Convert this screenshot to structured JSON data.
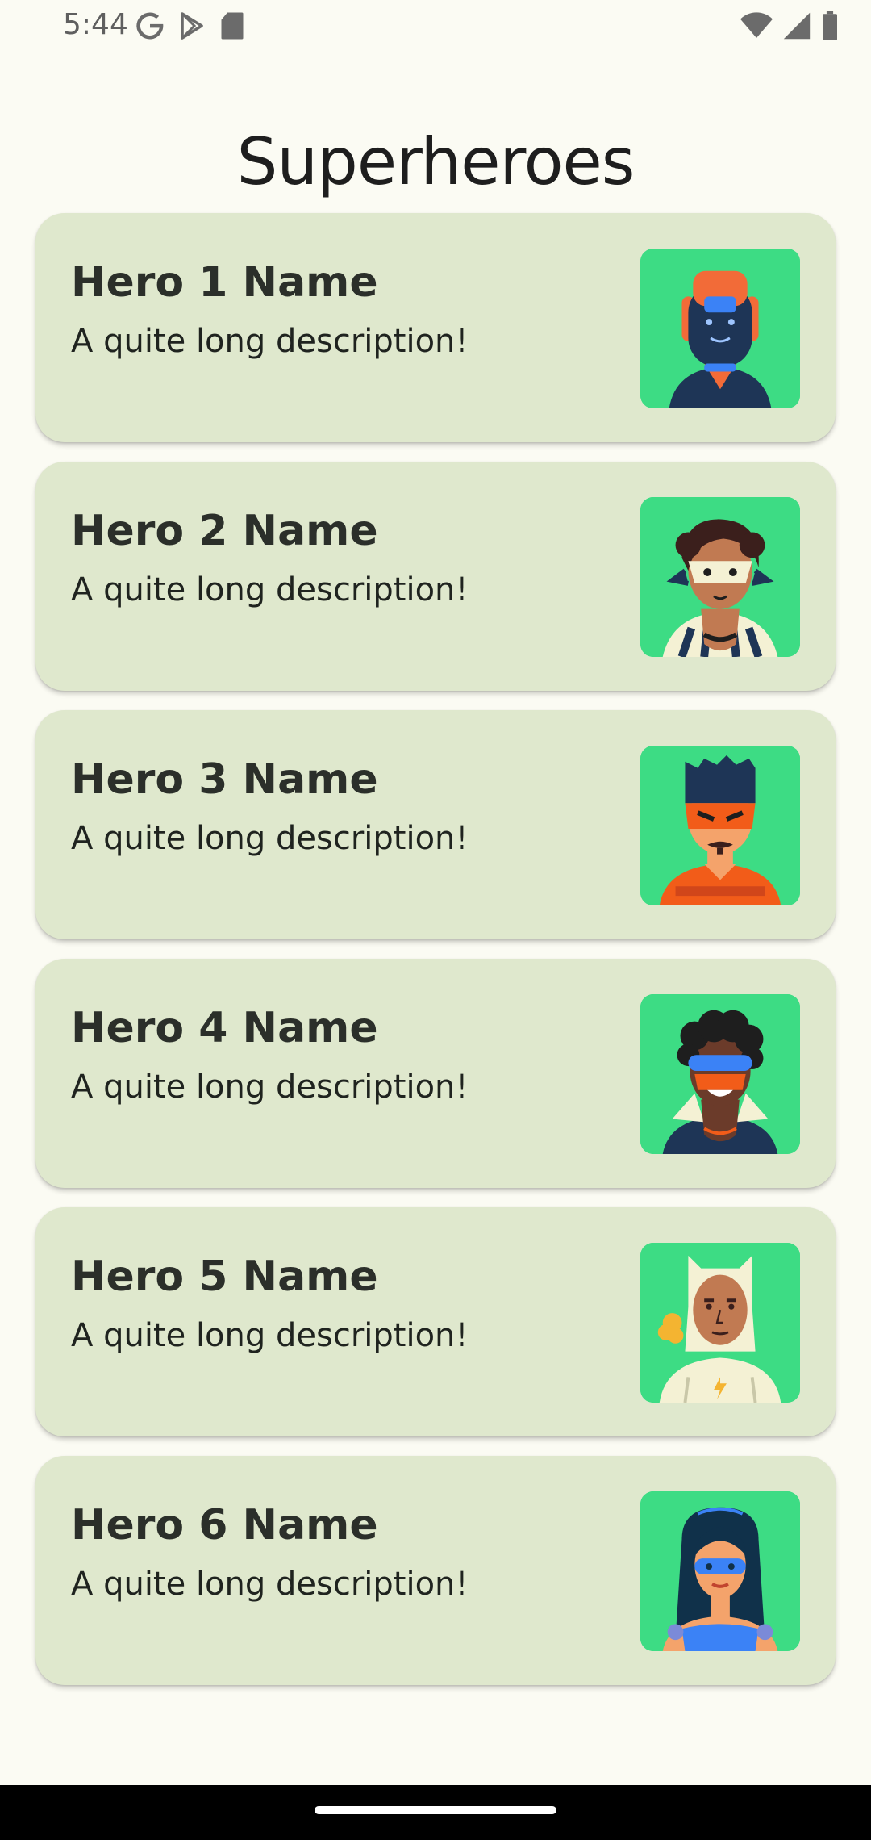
{
  "status_bar": {
    "time": "5:44",
    "left_icons": [
      "google-icon",
      "play-store-icon",
      "sd-card-icon"
    ],
    "right_icons": [
      "wifi-icon",
      "signal-icon",
      "battery-icon"
    ]
  },
  "app": {
    "title": "Superheroes"
  },
  "heroes": [
    {
      "name": "Hero 1 Name",
      "description": "A quite long description!",
      "avatar_icon": "hero-1-avatar"
    },
    {
      "name": "Hero 2 Name",
      "description": "A quite long description!",
      "avatar_icon": "hero-2-avatar"
    },
    {
      "name": "Hero 3 Name",
      "description": "A quite long description!",
      "avatar_icon": "hero-3-avatar"
    },
    {
      "name": "Hero 4 Name",
      "description": "A quite long description!",
      "avatar_icon": "hero-4-avatar"
    },
    {
      "name": "Hero 5 Name",
      "description": "A quite long description!",
      "avatar_icon": "hero-5-avatar"
    },
    {
      "name": "Hero 6 Name",
      "description": "A quite long description!",
      "avatar_icon": "hero-6-avatar"
    }
  ],
  "colors": {
    "background": "#fbfbf3",
    "card": "#dfe8cd",
    "avatar_bg": "#3ddc84",
    "text": "#2b2f2a"
  }
}
